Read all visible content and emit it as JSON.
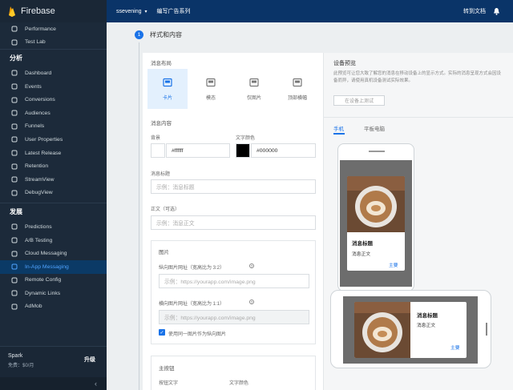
{
  "app": {
    "name": "Firebase"
  },
  "topbar": {
    "project": "ssevening",
    "dropdown": "▾",
    "breadcrumb": "编写广告系列",
    "docs": "转到文档"
  },
  "sidebar": {
    "items_top": [
      {
        "label": "Performance",
        "icon": "speed-icon"
      },
      {
        "label": "Test Lab",
        "icon": "test-lab-icon"
      }
    ],
    "section_analytics": "分析",
    "items_analytics": [
      {
        "label": "Dashboard",
        "icon": "bar-chart-icon"
      },
      {
        "label": "Events",
        "icon": "events-icon"
      },
      {
        "label": "Conversions",
        "icon": "flag-icon"
      },
      {
        "label": "Audiences",
        "icon": "people-icon"
      },
      {
        "label": "Funnels",
        "icon": "funnel-icon"
      },
      {
        "label": "User Properties",
        "icon": "user-properties-icon"
      },
      {
        "label": "Latest Release",
        "icon": "release-icon"
      },
      {
        "label": "Retention",
        "icon": "retention-icon"
      },
      {
        "label": "StreamView",
        "icon": "streamview-icon"
      },
      {
        "label": "DebugView",
        "icon": "debug-icon"
      }
    ],
    "section_grow": "发展",
    "items_grow": [
      {
        "label": "Predictions",
        "icon": "predictions-icon"
      },
      {
        "label": "A/B Testing",
        "icon": "ab-testing-icon"
      },
      {
        "label": "Cloud Messaging",
        "icon": "cloud-messaging-icon"
      },
      {
        "label": "In-App Messaging",
        "icon": "in-app-messaging-icon",
        "active": true
      },
      {
        "label": "Remote Config",
        "icon": "remote-config-icon"
      },
      {
        "label": "Dynamic Links",
        "icon": "link-icon"
      },
      {
        "label": "AdMob",
        "icon": "admob-icon"
      }
    ],
    "plan": "Spark",
    "plan_sub": "免费：$0/月",
    "upgrade": "升级",
    "collapse": "‹"
  },
  "step": {
    "number": "1",
    "title": "样式和内容"
  },
  "form": {
    "layout_label": "消息布局",
    "layouts": [
      {
        "label": "卡片",
        "icon": "card-layout-icon",
        "selected": true
      },
      {
        "label": "模态",
        "icon": "modal-layout-icon"
      },
      {
        "label": "仅图片",
        "icon": "image-only-icon"
      },
      {
        "label": "顶部横幅",
        "icon": "top-banner-icon"
      }
    ],
    "content_label": "消息内容",
    "bg_label": "背景",
    "bg_value": "#ffffff",
    "text_color_label": "文字颜色",
    "text_color_value": "#000000",
    "title_label": "消息标题",
    "title_placeholder": "示例：消息标题",
    "body_label": "正文（可选）",
    "body_placeholder": "示例：消息正文",
    "image_section": "图片",
    "portrait_label": "纵向图片网址（宽高比为 3:2）",
    "portrait_placeholder": "示例：https://yourapp.com/image.png",
    "landscape_label": "横向图片网址（宽高比为 1:1）",
    "landscape_placeholder": "示例：https://yourapp.com/image.png",
    "same_image_label": "使用同一图片作为纵向图片",
    "primary_button_section": "主按钮",
    "button_text_label": "按钮文字",
    "button_text_color_label": "文字颜色"
  },
  "preview": {
    "title": "设备预览",
    "description": "此预览可让您大致了解您的消息在移动设备上的显示方式。实际的消息呈现方式会因设备而异，请使用真机设备测试实际效果。",
    "test_button": "在设备上测试",
    "tab_phone": "手机",
    "tab_tablet": "平板电脑",
    "message_title": "消息标题",
    "message_body": "消息正文",
    "message_button": "主要"
  }
}
